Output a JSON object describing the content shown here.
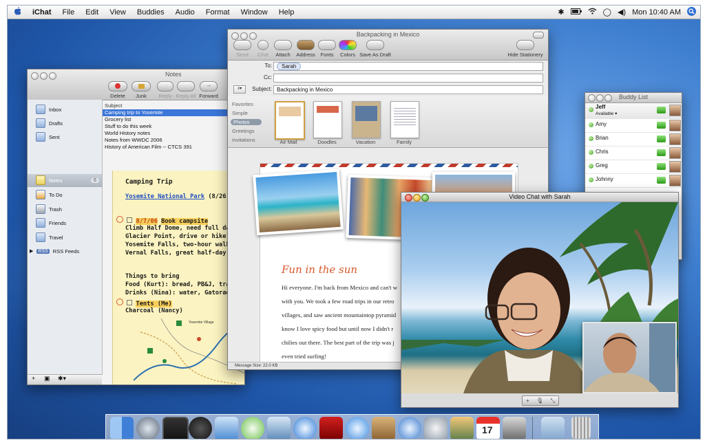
{
  "menubar": {
    "apple": "",
    "items": [
      "iChat",
      "File",
      "Edit",
      "View",
      "Buddies",
      "Audio",
      "Format",
      "Window",
      "Help"
    ],
    "clock": "Mon 10:40 AM"
  },
  "mail": {
    "title": "Notes",
    "toolbar": {
      "delete": "Delete",
      "junk": "Junk",
      "reply": "Reply",
      "reply_all": "Reply All",
      "forward": "Forward"
    },
    "mailboxes": [
      "Inbox",
      "Drafts",
      "Sent",
      "Notes",
      "To Do",
      "Trash",
      "Friends",
      "Travel",
      "RSS Feeds"
    ],
    "notes_count": "6",
    "list_header": "Subject",
    "messages": [
      "Camping trip to Yosemite",
      "Grocery list",
      "Stuff to do this week",
      "World History notes",
      "Notes from WWDC 2006",
      "History of American Film -- CTCS 391"
    ],
    "note": {
      "title": "Camping Trip",
      "link": "Yosemite National Park",
      "link_suffix": "(8/26 - 8",
      "date_line": "8/7/06",
      "book": "Book campsite",
      "lines1": [
        "Climb Half Dome, need full day",
        "Glacier Point, drive or hike?",
        "Yosemite Falls, two-hour walk",
        "Vernal Falls, great half-day hike"
      ],
      "bring_header": "Things to bring",
      "lines2": [
        "Food (Kurt): bread, PB&J, trail mix",
        "Drinks (Nina): water, Gatorade, soda"
      ],
      "tents": "Tents (Me)",
      "charcoal": "Charcoal (Nancy)",
      "map_label": "Yosemite Village"
    }
  },
  "compose": {
    "title": "Backpacking in Mexico",
    "toolbar": [
      "Send",
      "Chat",
      "Attach",
      "Address",
      "Fonts",
      "Colors",
      "Save As Draft"
    ],
    "hide_stationery": "Hide Stationery",
    "to_label": "To:",
    "to_value": "Sarah",
    "cc_label": "Cc:",
    "subject_label": "Subject:",
    "subject_value": "Backpacking in Mexico",
    "stationery_categories": [
      "Favorites",
      "Simple",
      "Photos",
      "Greetings",
      "Invitations"
    ],
    "stationery_thumbs": [
      "Air Mail",
      "Doodles",
      "Vacation",
      "Family"
    ],
    "heading": "Fun in the sun",
    "body_lines": [
      "Hi everyone. I'm back from Mexico and can't w",
      "with you. We took a few road trips in our retro",
      "villages, and saw ancient mountaintop pyramid",
      "know I love spicy food but until now I didn't r",
      "chilies out there. The best part of the trip was j",
      "even tried surfing!"
    ],
    "message_size": "Message Size: 22.0 KB"
  },
  "buddy_list": {
    "title": "Buddy List",
    "me": {
      "name": "Jeff",
      "status": "Available"
    },
    "buddies": [
      "Amy",
      "Brian",
      "Chris",
      "Greg",
      "Johnny"
    ]
  },
  "video": {
    "title": "Video Chat with Sarah"
  },
  "dock": {
    "apps": [
      "finder",
      "dashboard",
      "expose",
      "front-row",
      "mail",
      "itunes",
      "preview",
      "safari",
      "dvd-player",
      "ichat",
      "address-book",
      "quicktime",
      "automator",
      "iphoto",
      "ical",
      "photo-booth",
      "folder",
      "trash"
    ]
  }
}
